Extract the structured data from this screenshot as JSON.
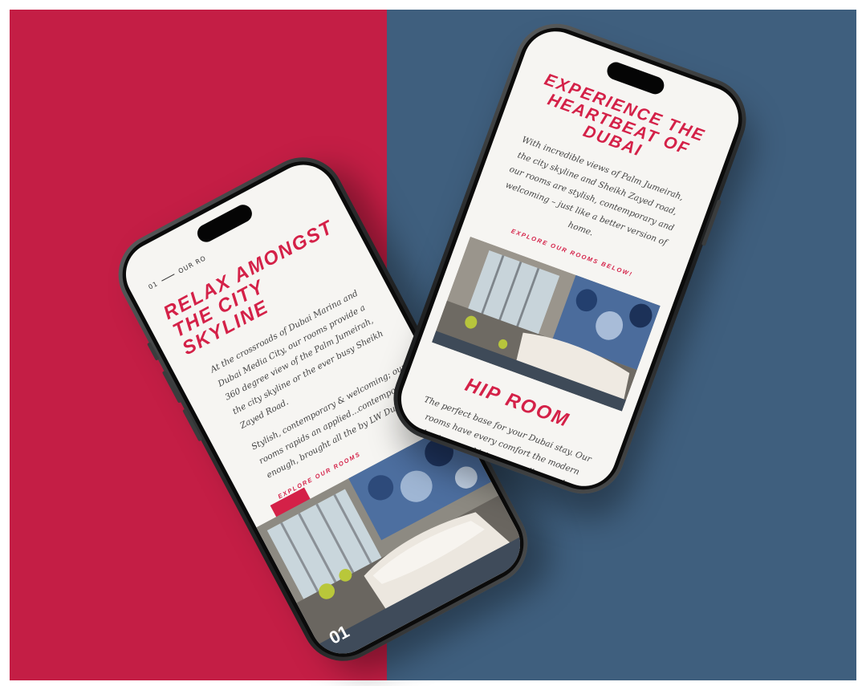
{
  "colors": {
    "left_background": "#c41e45",
    "right_background": "#3f5f7e",
    "accent_red": "#d42148",
    "screen_bg": "#f6f5f2",
    "frame_dark": "#1c1d1e"
  },
  "left_phone": {
    "topbar_number": "01",
    "topbar_label": "OUR RO",
    "title": "RELAX AMONGST THE CITY SKYLINE",
    "paragraph_1": "At the crossroads of Dubai Marina and Dubai Media City, our rooms provide a 360 degree view of the Palm Jumeirah, the city skyline or the ever busy Sheikh Zayed Road.",
    "paragraph_2": "Stylish, contemporary & welcoming; our rooms rapids an applied...contemporary enough, brought all the by LW Dubai.",
    "link_label": "EXPLORE OUR ROOMS",
    "room_number": "01",
    "room_image_icon": "hotel-room-photo"
  },
  "right_phone": {
    "title": "EXPERIENCE THE HEARTBEAT OF DUBAI",
    "intro": "With incredible views of Palm Jumeirah, the city skyline and Sheikh Zayed road, our rooms are stylish, contemporary and welcoming – just like a better version of home.",
    "link_label": "EXPLORE OUR ROOMS BELOW!",
    "room_image_icon": "hotel-room-photo",
    "room_name": "HIP ROOM",
    "room_description": "The perfect base for your Dubai stay. Our rooms have every comfort the modern business and leisure traveller needs."
  }
}
